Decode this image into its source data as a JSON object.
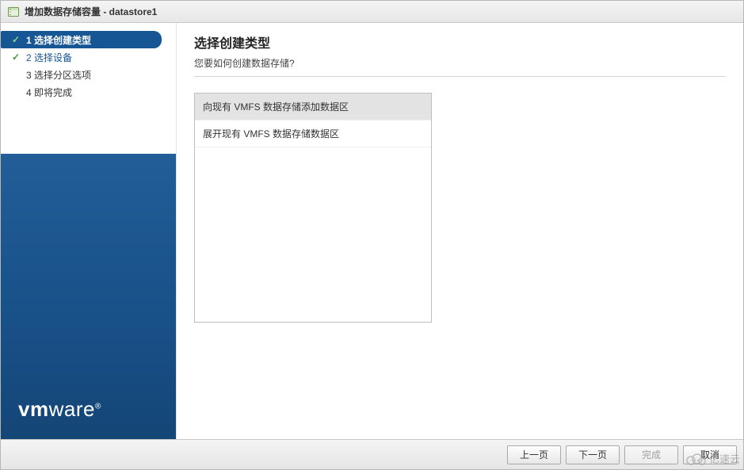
{
  "window": {
    "title": "增加数据存储容量 - datastore1"
  },
  "sidebar": {
    "steps": [
      {
        "num": "1",
        "label": "选择创建类型",
        "state": "active",
        "checked": true
      },
      {
        "num": "2",
        "label": "选择设备",
        "state": "done",
        "checked": true
      },
      {
        "num": "3",
        "label": "选择分区选项",
        "state": "future",
        "checked": false
      },
      {
        "num": "4",
        "label": "即将完成",
        "state": "future",
        "checked": false
      }
    ],
    "brand": "vmware"
  },
  "main": {
    "heading": "选择创建类型",
    "subtitle": "您要如何创建数据存储?",
    "options": [
      {
        "label": "向现有 VMFS 数据存储添加数据区",
        "selected": true
      },
      {
        "label": "展开现有 VMFS 数据存储数据区",
        "selected": false
      }
    ]
  },
  "footer": {
    "back": "上一页",
    "next": "下一页",
    "finish": "完成",
    "cancel": "取消"
  },
  "watermark": "亿速云"
}
